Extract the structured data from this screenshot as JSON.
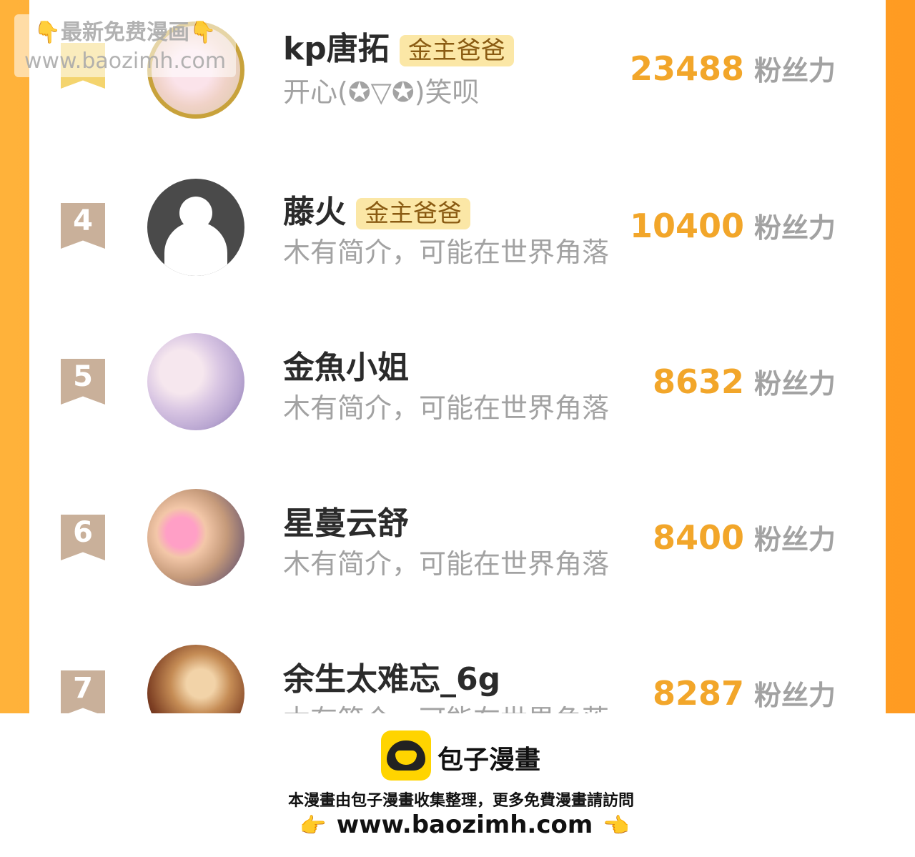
{
  "watermark": {
    "line1": "👇最新免费漫画👇",
    "line2": "www.baozimh.com"
  },
  "ranking": [
    {
      "rank": "",
      "name": "kp唐拓",
      "tag": "金主爸爸",
      "intro": "开心(✪▽✪)笑呗",
      "score": "23488",
      "unit": "粉丝力"
    },
    {
      "rank": "4",
      "name": "藤火",
      "tag": "金主爸爸",
      "intro": "木有简介，可能在世界角落",
      "score": "10400",
      "unit": "粉丝力"
    },
    {
      "rank": "5",
      "name": "金魚小姐",
      "tag": "",
      "intro": "木有简介，可能在世界角落",
      "score": "8632",
      "unit": "粉丝力"
    },
    {
      "rank": "6",
      "name": "星蔓云舒",
      "tag": "",
      "intro": "木有简介，可能在世界角落",
      "score": "8400",
      "unit": "粉丝力"
    },
    {
      "rank": "7",
      "name": "余生太难忘_6g",
      "tag": "",
      "intro": "木有简介，可能在世界角落",
      "score": "8287",
      "unit": "粉丝力"
    }
  ],
  "footer": {
    "brand": "包子漫畫",
    "credit": "本漫畫由包子漫畫收集整理，更多免費漫畫請訪問",
    "url": "www.baozimh.com",
    "hand_left": "👉",
    "hand_right": "👈"
  }
}
